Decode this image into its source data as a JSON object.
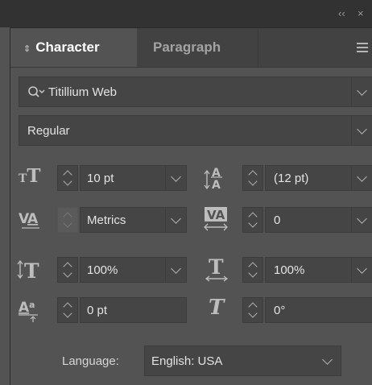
{
  "window": {
    "collapse_icon": "double-chevron-left-icon",
    "close_icon": "close-icon",
    "collapse_glyph": "‹‹",
    "close_glyph": "×"
  },
  "tabs": [
    {
      "label": "Character",
      "active": true,
      "icon": "updown-arrows-icon"
    },
    {
      "label": "Paragraph",
      "active": false
    }
  ],
  "font": {
    "family": "Titillium Web",
    "style": "Regular"
  },
  "metrics": {
    "font_size": "10 pt",
    "leading": "(12 pt)",
    "kerning": "Metrics",
    "tracking": "0",
    "vertical_scale": "100%",
    "horizontal_scale": "100%",
    "baseline_shift": "0 pt",
    "skew": "0°"
  },
  "language": {
    "label": "Language:",
    "value": "English: USA"
  },
  "colors": {
    "panel_bg": "#535353",
    "field_bg": "#454545",
    "topbar_bg": "#323232",
    "text": "#e3e3e3"
  }
}
